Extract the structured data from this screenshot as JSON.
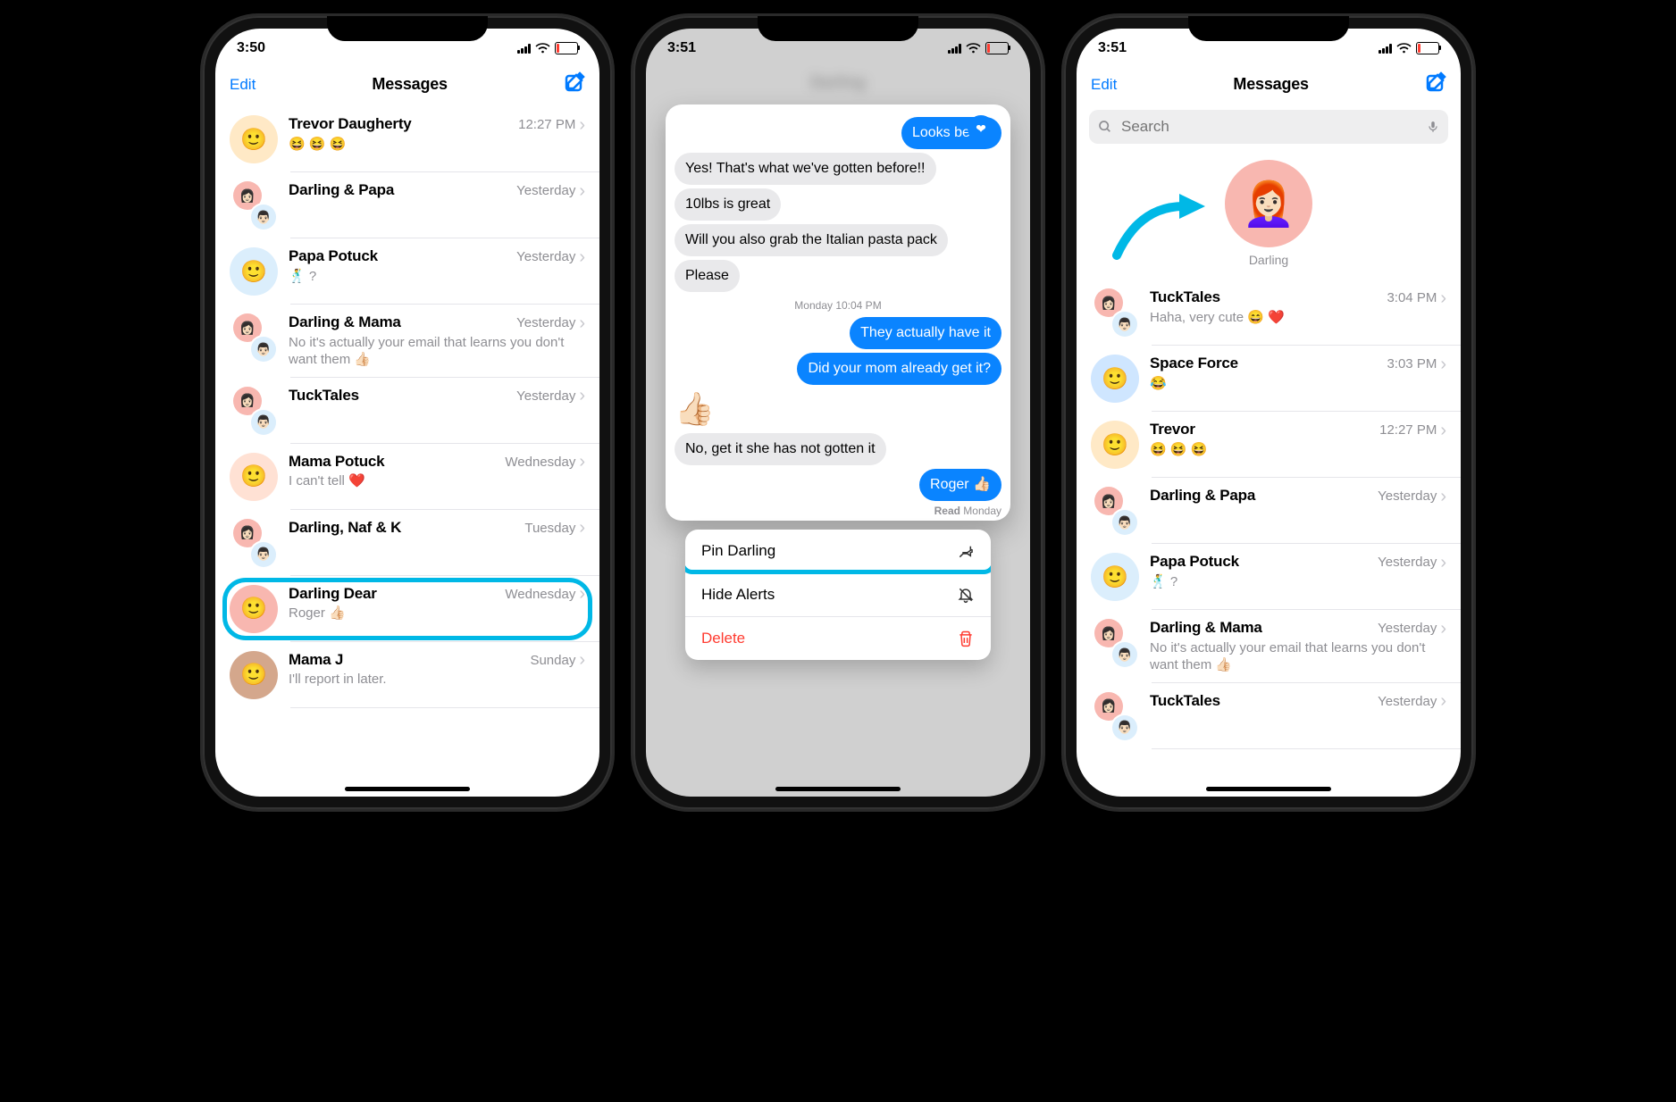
{
  "annotations": {
    "highlight_color": "#00b8e6"
  },
  "phone1": {
    "time": "3:50",
    "nav": {
      "edit": "Edit",
      "title": "Messages"
    },
    "list": [
      {
        "name": "Trevor Daugherty",
        "time": "12:27 PM",
        "preview": "😆 😆 😆",
        "avatar_bg": "#ffe9c6"
      },
      {
        "name": "Darling & Papa",
        "time": "Yesterday",
        "preview": "",
        "group": true
      },
      {
        "name": "Papa Potuck",
        "time": "Yesterday",
        "preview": "🕺 ?",
        "avatar_bg": "#dbeefc"
      },
      {
        "name": "Darling & Mama",
        "time": "Yesterday",
        "preview": "No it's actually your email that learns you don't want them 👍🏻",
        "group": true
      },
      {
        "name": "TuckTales",
        "time": "Yesterday",
        "preview": "",
        "group": true
      },
      {
        "name": "Mama Potuck",
        "time": "Wednesday",
        "preview": "I can't tell ❤️",
        "avatar_bg": "#ffe1d4"
      },
      {
        "name": "Darling, Naf & K",
        "time": "Tuesday",
        "preview": "",
        "group": true
      },
      {
        "name": "Darling Dear",
        "time": "Wednesday",
        "preview": "Roger 👍🏻",
        "avatar_bg": "#f8b7b0",
        "highlighted": true
      },
      {
        "name": "Mama J",
        "time": "Sunday",
        "preview": "I'll report in later.",
        "avatar_bg": "#d4a78c"
      }
    ]
  },
  "phone2": {
    "time": "3:51",
    "messages": {
      "top_outgoing": "Looks better",
      "m1": "Yes! That's what we've gotten before!!",
      "m2": "10lbs is great",
      "m3": "Will you also grab the Italian pasta pack",
      "m4": "Please",
      "timestamp": "Monday 10:04 PM",
      "m5": "They actually have it",
      "m6": "Did your mom already get it?",
      "m7": "No, get it she has not gotten it",
      "m8": "Roger 👍🏻",
      "read_label": "Read",
      "read_time": "Monday"
    },
    "menu": {
      "pin": "Pin Darling",
      "hide": "Hide Alerts",
      "delete": "Delete"
    }
  },
  "phone3": {
    "time": "3:51",
    "nav": {
      "edit": "Edit",
      "title": "Messages"
    },
    "search_placeholder": "Search",
    "pinned": {
      "name": "Darling"
    },
    "list": [
      {
        "name": "TuckTales",
        "time": "3:04 PM",
        "preview": "Haha, very cute 😄 ❤️",
        "group": true
      },
      {
        "name": "Space Force",
        "time": "3:03 PM",
        "preview": "😂",
        "avatar_bg": "#cfe6ff"
      },
      {
        "name": "Trevor",
        "time": "12:27 PM",
        "preview": "😆 😆 😆",
        "avatar_bg": "#ffe9c6"
      },
      {
        "name": "Darling & Papa",
        "time": "Yesterday",
        "preview": "",
        "group": true
      },
      {
        "name": "Papa Potuck",
        "time": "Yesterday",
        "preview": "🕺 ?",
        "avatar_bg": "#dbeefc"
      },
      {
        "name": "Darling & Mama",
        "time": "Yesterday",
        "preview": "No it's actually your email that learns you don't want them 👍🏻",
        "group": true
      },
      {
        "name": "TuckTales",
        "time": "Yesterday",
        "preview": "",
        "group": true
      }
    ]
  }
}
